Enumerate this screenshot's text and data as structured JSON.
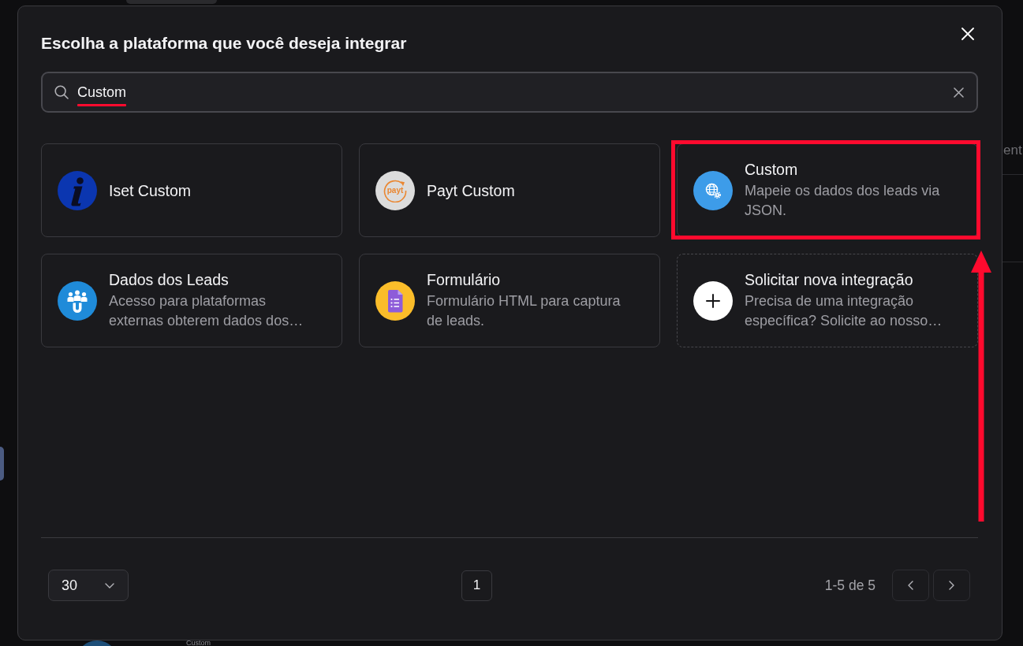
{
  "background": {
    "column_header": "ent",
    "row_label": "Custom"
  },
  "dialog": {
    "title": "Escolha a plataforma que você deseja integrar"
  },
  "search": {
    "value": "Custom",
    "underlined": true
  },
  "cards": [
    {
      "kind": "integration",
      "title": "Iset Custom",
      "highlighted": false
    },
    {
      "kind": "integration",
      "title": "Payt Custom",
      "logo_text": "payt",
      "highlighted": false
    },
    {
      "kind": "integration",
      "title": "Custom",
      "description": "Mapeie os dados dos leads via JSON.",
      "highlighted": true
    },
    {
      "kind": "integration",
      "title": "Dados dos Leads",
      "description": "Acesso para plataformas externas obterem dados dos…",
      "highlighted": false
    },
    {
      "kind": "integration",
      "title": "Formulário",
      "description": "Formulário HTML para captura de leads.",
      "highlighted": false
    },
    {
      "kind": "request",
      "title": "Solicitar nova integração",
      "description": "Precisa de uma integração específica? Solicite ao nosso…",
      "highlighted": false
    }
  ],
  "annotation": {
    "arrow": true
  },
  "footer": {
    "page_size": "30",
    "pages": [
      "1"
    ],
    "range": "1-5 de 5"
  }
}
